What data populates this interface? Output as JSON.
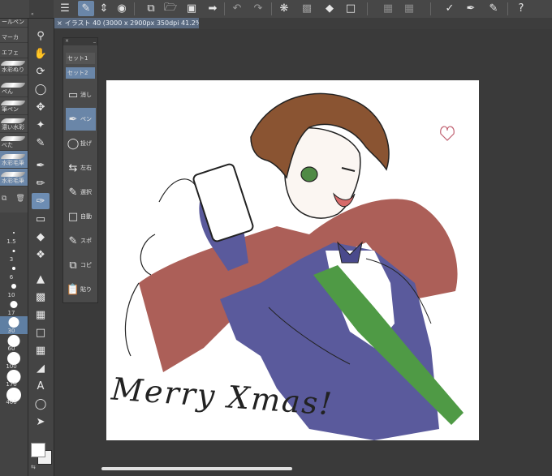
{
  "document_tab": {
    "close": "×",
    "title": "イラスト 40 (3000 x 2900px 350dpi 41.2%)"
  },
  "toolbar": {
    "icons": [
      "menu-icon",
      "canvas-edit-icon",
      "chevrons-icon",
      "quick-access-icon",
      "new-file-icon",
      "open-folder-icon",
      "save-icon",
      "export-icon",
      "undo-icon",
      "redo-icon",
      "loading-icon",
      "snap-icon",
      "fill-icon",
      "transform-icon",
      "ruler-icon",
      "stabilizer-icon",
      "pen-settings-icon",
      "help-icon"
    ]
  },
  "brush_panel": {
    "items": [
      {
        "label": "ールペン"
      },
      {
        "label": "マーカ"
      },
      {
        "label": "エフェ"
      },
      {
        "label": "水彩ぬり"
      },
      {
        "label": "ペん"
      },
      {
        "label": "筆ペン"
      },
      {
        "label": "濃い水彩"
      },
      {
        "label": "べた"
      },
      {
        "label": "水彩毛筆"
      },
      {
        "label": "水彩毛筆"
      }
    ]
  },
  "size_panel": {
    "sizes": [
      "1.5",
      "3",
      "6",
      "10",
      "17",
      "30",
      "60",
      "100",
      "170",
      "400"
    ],
    "selected": "30"
  },
  "sub_tool_palette": {
    "sets": [
      "セット1",
      "セット2"
    ],
    "selected_set": "セット2",
    "items": [
      {
        "icon": "eraser-icon",
        "label": "消し"
      },
      {
        "icon": "pen-icon",
        "label": "ペン"
      },
      {
        "icon": "lasso-icon",
        "label": "投げ"
      },
      {
        "icon": "flip-icon",
        "label": "左右"
      },
      {
        "icon": "select-pen-icon",
        "label": "選択"
      },
      {
        "icon": "auto-select-icon",
        "label": "自動"
      },
      {
        "icon": "eyedropper-icon",
        "label": "スポ"
      },
      {
        "icon": "copy-icon",
        "label": "コピ"
      },
      {
        "icon": "paste-icon",
        "label": "貼り"
      }
    ]
  },
  "canvas": {
    "handwriting": "Merry Xmas!"
  },
  "colors": {
    "accent": "#6a86a8",
    "ui_bg": "#3a3a3a",
    "cape_red": "#a8564f",
    "jacket_blue": "#5a5a9c",
    "sash_green": "#4f9a45",
    "hair_brown": "#8a5432"
  }
}
